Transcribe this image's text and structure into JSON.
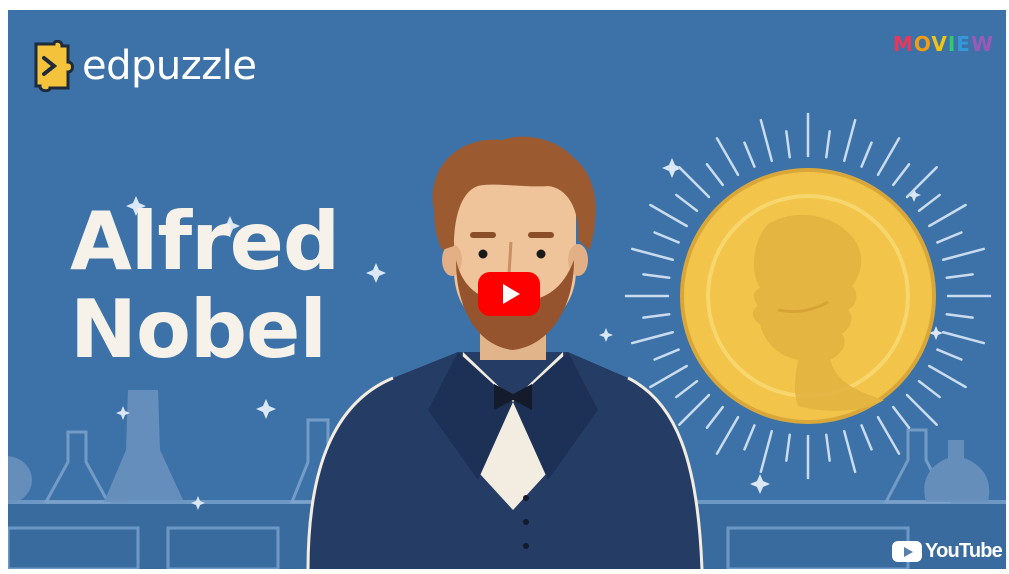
{
  "video": {
    "title_line1": "Alfred",
    "title_line2": "Nobel",
    "provider": "edpuzzle",
    "brand_letters": [
      "M",
      "O",
      "V",
      "I",
      "E",
      "W"
    ],
    "youtube_label": "YouTube"
  },
  "colors": {
    "background": "#3d72a8",
    "play_button": "#ff0000",
    "medal_gold": "#f2c449",
    "edpuzzle_yellow": "#f5c33b",
    "brand_colors": [
      "#e8365d",
      "#f39c12",
      "#f1c40f",
      "#2ecc71",
      "#3498db",
      "#9b59b6"
    ]
  },
  "icons": {
    "logo": "edpuzzle-puzzle-icon",
    "play": "play-icon",
    "youtube": "youtube-icon"
  }
}
